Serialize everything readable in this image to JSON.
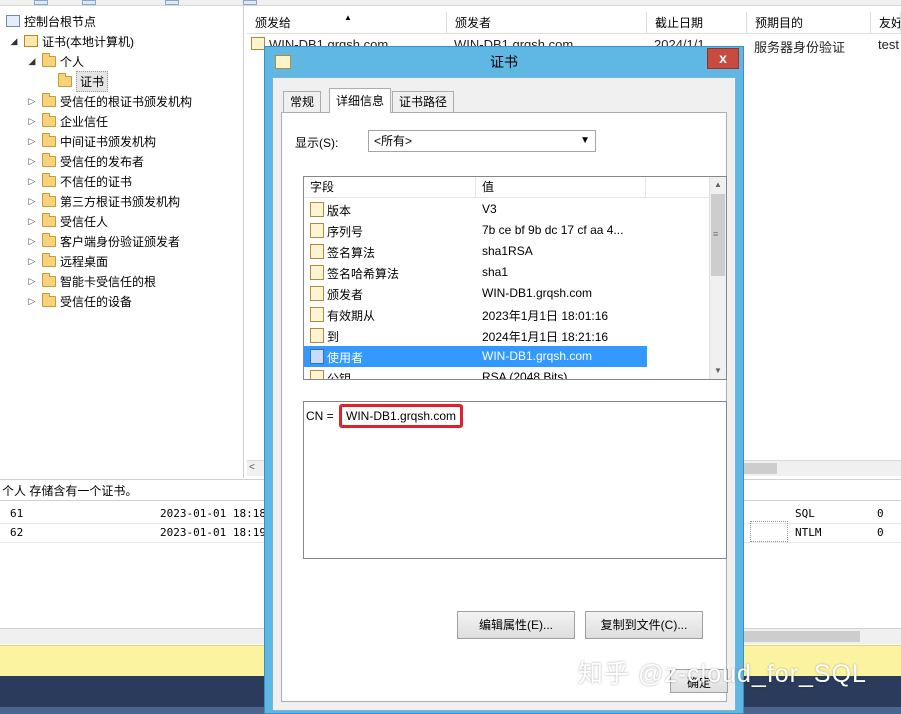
{
  "tree": {
    "root": "控制台根节点",
    "computer": "证书(本地计算机)",
    "personal": "个人",
    "certs": "证书",
    "items": [
      "受信任的根证书颁发机构",
      "企业信任",
      "中间证书颁发机构",
      "受信任的发布者",
      "不信任的证书",
      "第三方根证书颁发机构",
      "受信任人",
      "客户端身份验证颁发者",
      "远程桌面",
      "智能卡受信任的根",
      "受信任的设备"
    ]
  },
  "list": {
    "columns": [
      "颁发给",
      "颁发者",
      "截止日期",
      "预期目的",
      "友好"
    ],
    "row": {
      "issued_to": "WIN-DB1.grqsh.com",
      "issued_by": "WIN-DB1.grqsh.com",
      "expiry": "2024/1/1",
      "purpose": "服务器身份验证",
      "friendly": "test"
    }
  },
  "status_bar": "个人 存储含有一个证书。",
  "log_rows": [
    {
      "id": "61",
      "time": "2023-01-01 18:18:",
      "c1": "SQL",
      "c2": "0"
    },
    {
      "id": "62",
      "time": "2023-01-01 18:19:",
      "c1": "NTLM",
      "c2": "0"
    }
  ],
  "dialog": {
    "title": "证书",
    "close": "x",
    "tabs": [
      "常规",
      "详细信息",
      "证书路径"
    ],
    "show_label": "显示(S):",
    "show_value": "<所有>",
    "field_header": "字段",
    "value_header": "值",
    "fields": [
      {
        "name": "版本",
        "value": "V3"
      },
      {
        "name": "序列号",
        "value": "7b ce bf 9b dc 17 cf aa 4..."
      },
      {
        "name": "签名算法",
        "value": "sha1RSA"
      },
      {
        "name": "签名哈希算法",
        "value": "sha1"
      },
      {
        "name": "颁发者",
        "value": "WIN-DB1.grqsh.com"
      },
      {
        "name": "有效期从",
        "value": "2023年1月1日 18:01:16"
      },
      {
        "name": "到",
        "value": "2024年1月1日 18:21:16"
      },
      {
        "name": "使用者",
        "value": "WIN-DB1.grqsh.com"
      },
      {
        "name": "公钥",
        "value": "RSA (2048 Bits)"
      }
    ],
    "detail_prefix": "CN = ",
    "detail_value": "WIN-DB1.grqsh.com",
    "edit_button": "编辑属性(E)...",
    "copy_button": "复制到文件(C)...",
    "ok_button": "确定"
  },
  "watermark": "知乎 @z-cloud_for_SQL"
}
